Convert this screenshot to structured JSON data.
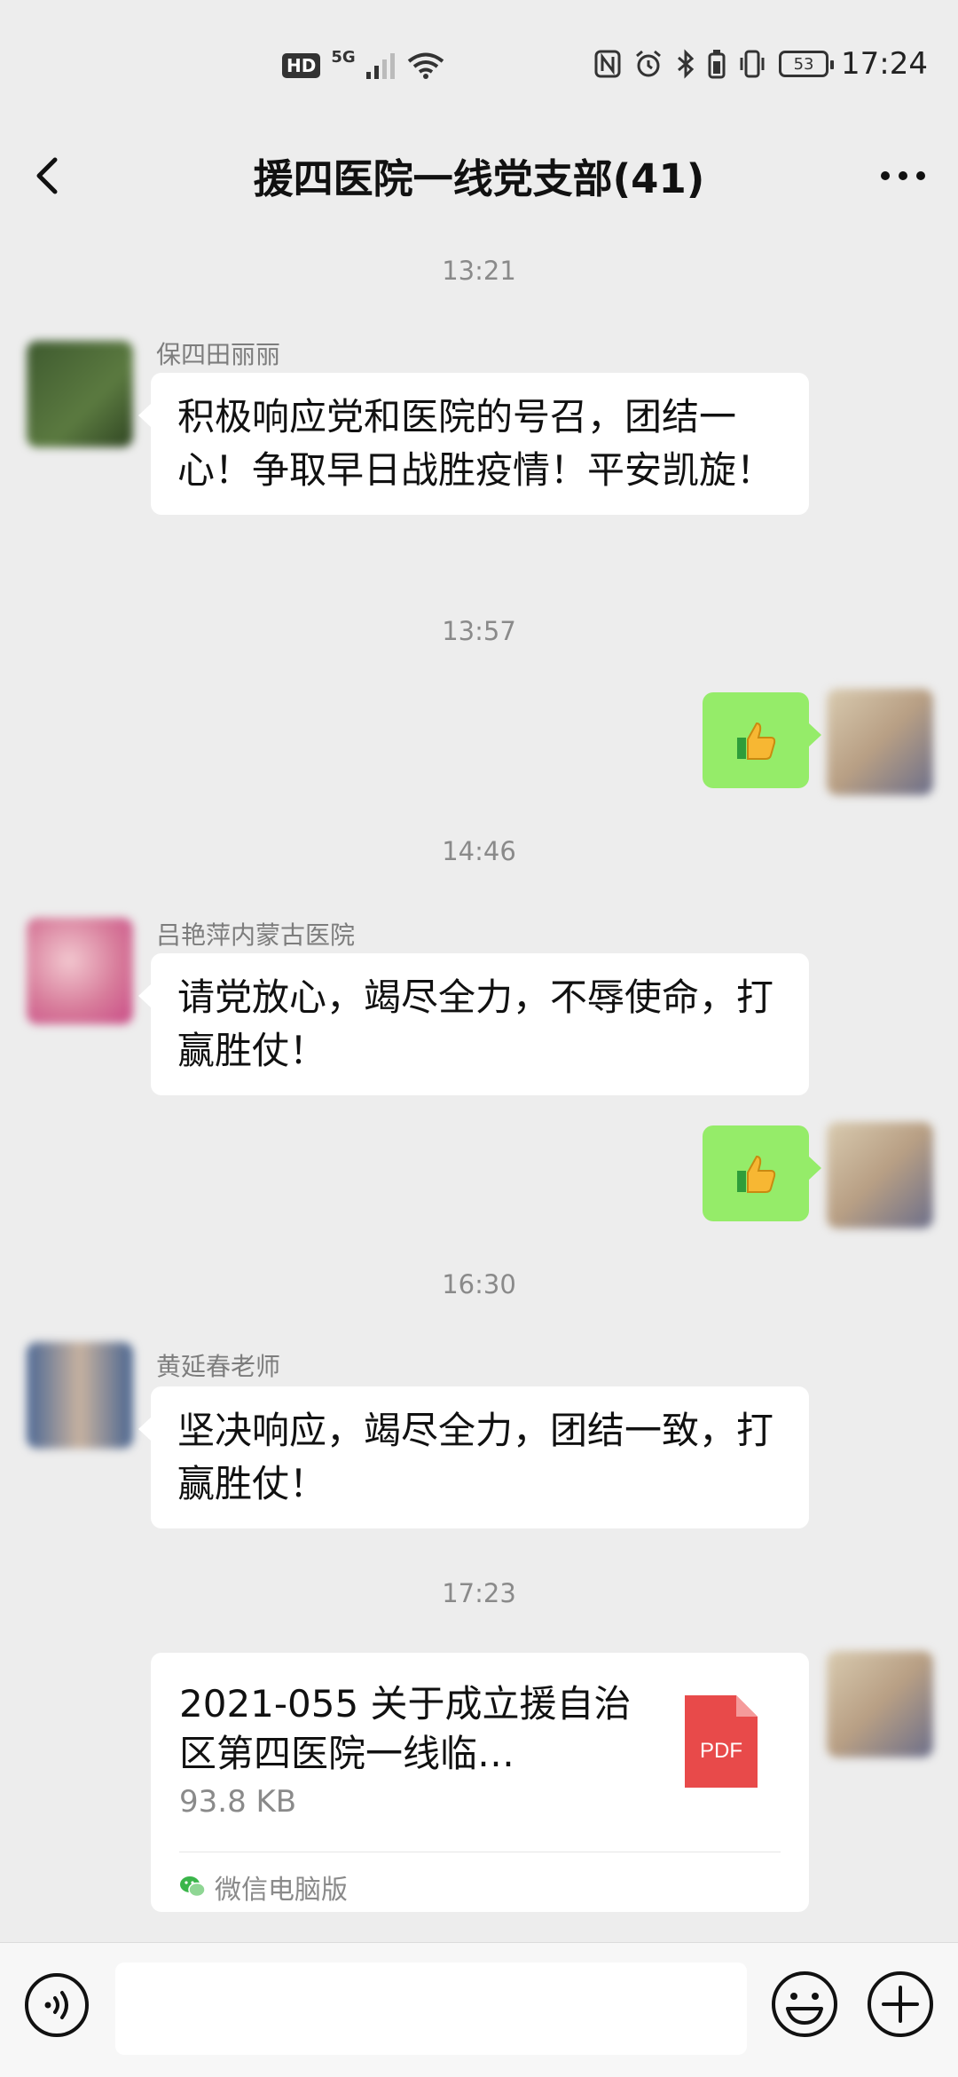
{
  "status_bar": {
    "hd": "HD",
    "network": "5G",
    "battery": "53",
    "time": "17:24"
  },
  "header": {
    "title": "援四医院一线党支部(41)"
  },
  "messages": [
    {
      "type": "time",
      "text": "13:21"
    },
    {
      "type": "incoming",
      "sender": "保四田丽丽",
      "text": "积极响应党和医院的号召，团结一心！争取早日战胜疫情！平安凯旋！"
    },
    {
      "type": "time",
      "text": "13:57"
    },
    {
      "type": "outgoing",
      "content": "thumbs-up"
    },
    {
      "type": "time",
      "text": "14:46"
    },
    {
      "type": "incoming",
      "sender": "吕艳萍内蒙古医院",
      "text": "请党放心，竭尽全力，不辱使命，打赢胜仗！"
    },
    {
      "type": "outgoing",
      "content": "thumbs-up"
    },
    {
      "type": "time",
      "text": "16:30"
    },
    {
      "type": "incoming",
      "sender": "黄延春老师",
      "text": "坚决响应，竭尽全力，团结一致，打赢胜仗！"
    },
    {
      "type": "time",
      "text": "17:23"
    },
    {
      "type": "file",
      "title": "2021-055 关于成立援自治区第四医院一线临…",
      "size": "93.8 KB",
      "file_type": "PDF",
      "source": "微信电脑版"
    }
  ],
  "input_bar": {
    "placeholder": ""
  },
  "colors": {
    "background": "#ededed",
    "outgoing_bubble": "#95ec69",
    "incoming_bubble": "#ffffff",
    "pdf_red": "#e84a4a"
  }
}
